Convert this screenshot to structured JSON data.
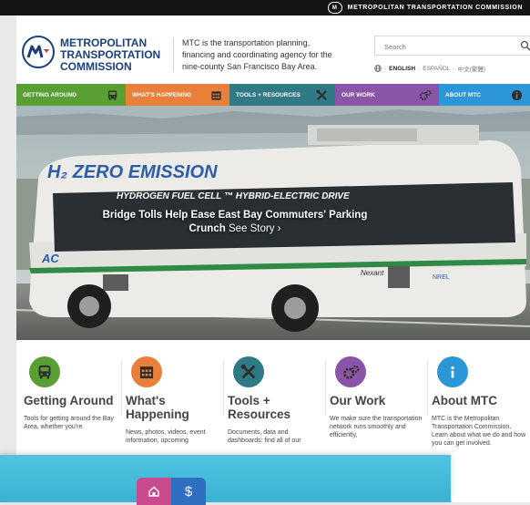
{
  "topbar": {
    "brand": "METROPOLITAN TRANSPORTATION COMMISSION"
  },
  "header": {
    "logo_lines": [
      "METROPOLITAN",
      "TRANSPORTATION",
      "COMMISSION"
    ],
    "tagline_lines": [
      "MTC is the transportation planning,",
      "financing and coordinating agency for the",
      "nine-county San Francisco Bay Area."
    ],
    "search_placeholder": "Search",
    "languages": [
      "ENGLISH",
      "ESPAÑOL",
      "中文(繁體)"
    ]
  },
  "nav": [
    {
      "label": "GETTING AROUND",
      "color": "#5a9f34",
      "icon": "bus-icon"
    },
    {
      "label": "WHAT'S HAPPENING",
      "color": "#e8803a",
      "icon": "calendar-icon"
    },
    {
      "label": "TOOLS + RESOURCES",
      "color": "#2f7a84",
      "icon": "tools-icon"
    },
    {
      "label": "OUR WORK",
      "color": "#8a55a6",
      "icon": "gears-icon"
    },
    {
      "label": "ABOUT MTC",
      "color": "#2c97d6",
      "icon": "info-icon"
    }
  ],
  "hero": {
    "caption": "Bridge Tolls Help Ease East Bay Commuters' Parking Crunch",
    "see_story": "See Story ›",
    "bus_lettering": [
      "H₂ ZERO EMISSION",
      "HYDROGEN FUEL CELL ™ HYBRID-ELECTRIC DRIVE",
      "AC",
      "Nexant",
      "NREL"
    ]
  },
  "cards": [
    {
      "title": "Getting Around",
      "desc": "Tools for getting around the Bay Area, whether you're",
      "color": "#5a9f34",
      "icon": "bus-icon"
    },
    {
      "title": "What's Happening",
      "desc": "News, photos, videos, event information, upcoming",
      "color": "#e8803a",
      "icon": "calendar-icon"
    },
    {
      "title": "Tools + Resources",
      "desc": "Documents, data and dashboards: find all of our",
      "color": "#2f7a84",
      "icon": "tools-icon"
    },
    {
      "title": "Our Work",
      "desc": "We make sure the transportation network runs smoothly and efficiently,",
      "color": "#8a55a6",
      "icon": "gears-icon"
    },
    {
      "title": "About MTC",
      "desc": "MTC is the Metropolitan Transportation Commission. Learn about what we do and how you can get involved.",
      "color": "#2c97d6",
      "icon": "info-icon"
    }
  ],
  "overlay": {
    "icons": [
      "house-icon",
      "dollar-icon"
    ],
    "icon2_glyph": "$",
    "colors": [
      "#c94a8f",
      "#2e6fc2"
    ]
  }
}
